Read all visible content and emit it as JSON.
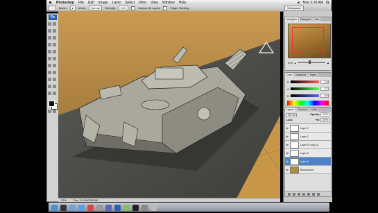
{
  "menubar": {
    "app_name": "Photoshop",
    "items": [
      "File",
      "Edit",
      "Image",
      "Layer",
      "Select",
      "Filter",
      "View",
      "Window",
      "Help"
    ],
    "clock": "Mon 2:26 AM"
  },
  "options_bar": {
    "brush_label": "Brush:",
    "mode_label": "Mode:",
    "mode_value": "Normal",
    "strength_label": "Strength:",
    "strength_value": "50%",
    "sample_all_label": "Sample All Layers",
    "finger_label": "Finger Painting",
    "workspace_label": "Workspace"
  },
  "toolbox": {
    "badge": "Ps"
  },
  "status_bar": {
    "zoom": "33%",
    "doc_info": "Doc: 49.2M/233.5M"
  },
  "navigator": {
    "tabs": [
      "Navigator",
      "Histogram",
      "Info"
    ],
    "zoom_value": "33%",
    "zoom_fraction": 0.4
  },
  "color_panel": {
    "tabs": [
      "Color",
      "Swatches",
      "Styles"
    ],
    "channels": [
      {
        "label": "R",
        "value": "214",
        "gradient": "#ff6060"
      },
      {
        "label": "G",
        "value": "177",
        "gradient": "#60ff60"
      },
      {
        "label": "B",
        "value": "102",
        "gradient": "#6060ff"
      }
    ]
  },
  "layers_panel": {
    "tabs": [
      "Layers",
      "Channels",
      "Paths"
    ],
    "blend_mode": "Normal",
    "opacity_label": "Opacity:",
    "opacity_value": "100%",
    "lock_label": "Lock:",
    "fill_label": "Fill:",
    "fill_value": "100%",
    "layers": [
      {
        "name": "Layer 2",
        "selected": false
      },
      {
        "name": "Layer 1",
        "selected": false
      },
      {
        "name": "Layer 10 copy 11",
        "selected": false
      },
      {
        "name": "Layer 5",
        "selected": false
      },
      {
        "name": "Layer 3",
        "selected": true
      },
      {
        "name": "Background",
        "selected": false
      }
    ]
  },
  "dock": {
    "icons": [
      "finder-icon",
      "dashboard-icon",
      "mail-icon",
      "safari-icon",
      "ical-icon",
      "address-book-icon",
      "itunes-icon",
      "photoshop-icon",
      "preview-icon",
      "terminal-icon",
      "system-preferences-icon",
      "trash-icon"
    ],
    "colors": [
      "#4a8fd8",
      "#333333",
      "#6fa0d8",
      "#5aa0e0",
      "#d44",
      "#999",
      "#56b",
      "#2f5fb0",
      "#8b6",
      "#222",
      "#888",
      "#bbb"
    ]
  }
}
